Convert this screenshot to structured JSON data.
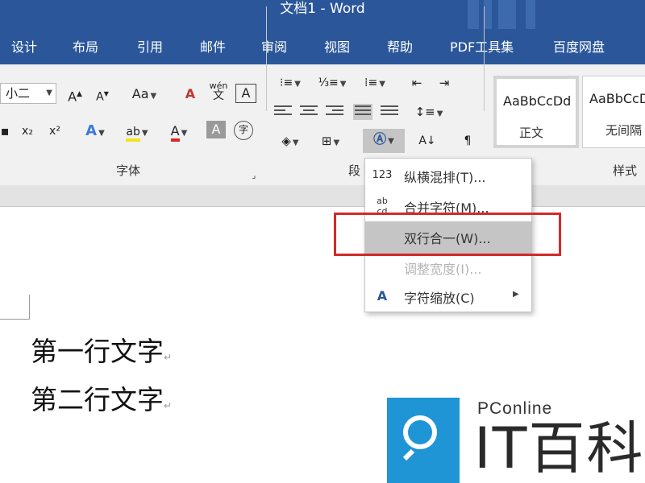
{
  "window": {
    "title": "文档1 - Word"
  },
  "tabs": [
    "设计",
    "布局",
    "引用",
    "邮件",
    "审阅",
    "视图",
    "帮助",
    "PDF工具集",
    "百度网盘"
  ],
  "font_group": {
    "font_size": "小二",
    "grow_font": "A",
    "shrink_font": "A",
    "change_case": "Aa",
    "clear_format": "A",
    "phonetic_top": "wén",
    "phonetic_bottom": "文",
    "char_border": "A",
    "subscript": "x₂",
    "superscript": "x²",
    "text_effects": "A",
    "highlight": "ab",
    "font_color": "A",
    "char_shading": "A",
    "enclose_char": "字",
    "label": "字体"
  },
  "paragraph_group": {
    "label": "段"
  },
  "styles_group": {
    "label": "样式",
    "items": [
      {
        "sample": "AaBbCcDd",
        "name": "正文"
      },
      {
        "sample": "AaBbCcDd",
        "name": "无间隔"
      }
    ]
  },
  "menu": {
    "items": [
      {
        "icon": "123",
        "label": "纵横混排(T)..."
      },
      {
        "icon": "ab cd",
        "label": "合并字符(M)..."
      },
      {
        "icon": "",
        "label": "双行合一(W)..."
      },
      {
        "icon": "",
        "label": "调整宽度(I)..."
      },
      {
        "icon": "A",
        "label": "字符缩放(C)"
      }
    ]
  },
  "document": {
    "lines": [
      "第一行文字",
      "第二行文字"
    ],
    "paragraph_mark": "↵"
  },
  "watermark": {
    "brand": "PConline",
    "name": "IT百科"
  },
  "colors": {
    "title_bar": "#2b579a",
    "ribbon": "#f1f1f1",
    "highlight_item": "#c5c5c5",
    "annotation_box": "#d22a2a",
    "logo_blue": "#1f95d6"
  }
}
